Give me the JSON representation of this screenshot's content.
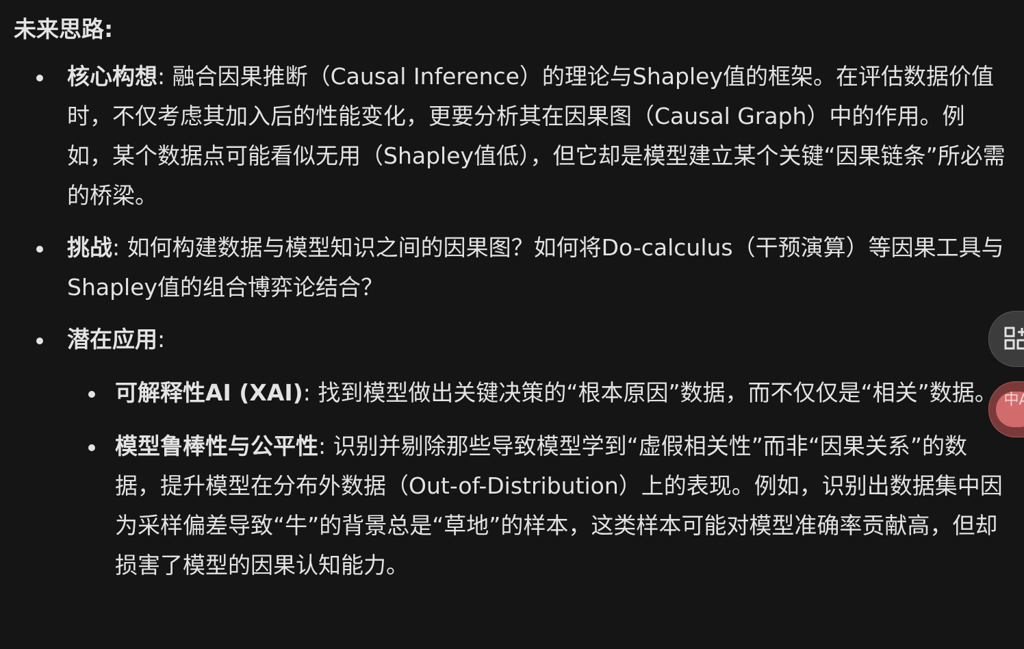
{
  "heading": "未来思路:",
  "items": [
    {
      "label": "核心构想",
      "text": ": 融合因果推断（Causal Inference）的理论与Shapley值的框架。在评估数据价值时，不仅考虑其加入后的性能变化，更要分析其在因果图（Causal Graph）中的作用。例如，某个数据点可能看似无用（Shapley值低），但它却是模型建立某个关键“因果链条”所必需的桥梁。"
    },
    {
      "label": "挑战",
      "text": ": 如何构建数据与模型知识之间的因果图？如何将Do-calculus（干预演算）等因果工具与Shapley值的组合博弈论结合？"
    },
    {
      "label": "潜在应用",
      "text": ":",
      "sub_items": [
        {
          "label": "可解释性AI (XAI)",
          "text": ": 找到模型做出关键决策的“根本原因”数据，而不仅仅是“相关”数据。"
        },
        {
          "label": "模型鲁棒性与公平性",
          "text": ": 识别并剔除那些导致模型学到“虚假相关性”而非“因果关系”的数据，提升模型在分布外数据（Out-of-Distribution）上的表现。例如，识别出数据集中因为采样偏差导致“牛”的背景总是“草地”的样本，这类样本可能对模型准确率贡献高，但却损害了模型的因果认知能力。"
        }
      ]
    }
  ],
  "floating": {
    "grid_icon": "grid-plus-icon",
    "translate_icon": "translate-icon",
    "translate_text": "中A"
  }
}
